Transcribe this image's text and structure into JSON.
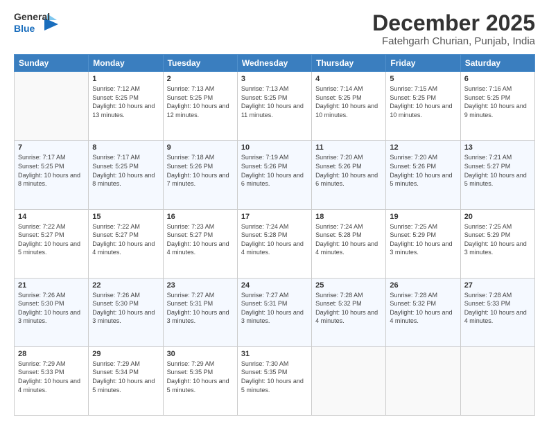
{
  "header": {
    "logo_general": "General",
    "logo_blue": "Blue",
    "month_title": "December 2025",
    "location": "Fatehgarh Churian, Punjab, India"
  },
  "weekdays": [
    "Sunday",
    "Monday",
    "Tuesday",
    "Wednesday",
    "Thursday",
    "Friday",
    "Saturday"
  ],
  "weeks": [
    [
      null,
      {
        "day": 1,
        "sunrise": "7:12 AM",
        "sunset": "5:25 PM",
        "daylight": "10 hours and 13 minutes."
      },
      {
        "day": 2,
        "sunrise": "7:13 AM",
        "sunset": "5:25 PM",
        "daylight": "10 hours and 12 minutes."
      },
      {
        "day": 3,
        "sunrise": "7:13 AM",
        "sunset": "5:25 PM",
        "daylight": "10 hours and 11 minutes."
      },
      {
        "day": 4,
        "sunrise": "7:14 AM",
        "sunset": "5:25 PM",
        "daylight": "10 hours and 10 minutes."
      },
      {
        "day": 5,
        "sunrise": "7:15 AM",
        "sunset": "5:25 PM",
        "daylight": "10 hours and 10 minutes."
      },
      {
        "day": 6,
        "sunrise": "7:16 AM",
        "sunset": "5:25 PM",
        "daylight": "10 hours and 9 minutes."
      }
    ],
    [
      {
        "day": 7,
        "sunrise": "7:17 AM",
        "sunset": "5:25 PM",
        "daylight": "10 hours and 8 minutes."
      },
      {
        "day": 8,
        "sunrise": "7:17 AM",
        "sunset": "5:25 PM",
        "daylight": "10 hours and 8 minutes."
      },
      {
        "day": 9,
        "sunrise": "7:18 AM",
        "sunset": "5:26 PM",
        "daylight": "10 hours and 7 minutes."
      },
      {
        "day": 10,
        "sunrise": "7:19 AM",
        "sunset": "5:26 PM",
        "daylight": "10 hours and 6 minutes."
      },
      {
        "day": 11,
        "sunrise": "7:20 AM",
        "sunset": "5:26 PM",
        "daylight": "10 hours and 6 minutes."
      },
      {
        "day": 12,
        "sunrise": "7:20 AM",
        "sunset": "5:26 PM",
        "daylight": "10 hours and 5 minutes."
      },
      {
        "day": 13,
        "sunrise": "7:21 AM",
        "sunset": "5:27 PM",
        "daylight": "10 hours and 5 minutes."
      }
    ],
    [
      {
        "day": 14,
        "sunrise": "7:22 AM",
        "sunset": "5:27 PM",
        "daylight": "10 hours and 5 minutes."
      },
      {
        "day": 15,
        "sunrise": "7:22 AM",
        "sunset": "5:27 PM",
        "daylight": "10 hours and 4 minutes."
      },
      {
        "day": 16,
        "sunrise": "7:23 AM",
        "sunset": "5:27 PM",
        "daylight": "10 hours and 4 minutes."
      },
      {
        "day": 17,
        "sunrise": "7:24 AM",
        "sunset": "5:28 PM",
        "daylight": "10 hours and 4 minutes."
      },
      {
        "day": 18,
        "sunrise": "7:24 AM",
        "sunset": "5:28 PM",
        "daylight": "10 hours and 4 minutes."
      },
      {
        "day": 19,
        "sunrise": "7:25 AM",
        "sunset": "5:29 PM",
        "daylight": "10 hours and 3 minutes."
      },
      {
        "day": 20,
        "sunrise": "7:25 AM",
        "sunset": "5:29 PM",
        "daylight": "10 hours and 3 minutes."
      }
    ],
    [
      {
        "day": 21,
        "sunrise": "7:26 AM",
        "sunset": "5:30 PM",
        "daylight": "10 hours and 3 minutes."
      },
      {
        "day": 22,
        "sunrise": "7:26 AM",
        "sunset": "5:30 PM",
        "daylight": "10 hours and 3 minutes."
      },
      {
        "day": 23,
        "sunrise": "7:27 AM",
        "sunset": "5:31 PM",
        "daylight": "10 hours and 3 minutes."
      },
      {
        "day": 24,
        "sunrise": "7:27 AM",
        "sunset": "5:31 PM",
        "daylight": "10 hours and 3 minutes."
      },
      {
        "day": 25,
        "sunrise": "7:28 AM",
        "sunset": "5:32 PM",
        "daylight": "10 hours and 4 minutes."
      },
      {
        "day": 26,
        "sunrise": "7:28 AM",
        "sunset": "5:32 PM",
        "daylight": "10 hours and 4 minutes."
      },
      {
        "day": 27,
        "sunrise": "7:28 AM",
        "sunset": "5:33 PM",
        "daylight": "10 hours and 4 minutes."
      }
    ],
    [
      {
        "day": 28,
        "sunrise": "7:29 AM",
        "sunset": "5:33 PM",
        "daylight": "10 hours and 4 minutes."
      },
      {
        "day": 29,
        "sunrise": "7:29 AM",
        "sunset": "5:34 PM",
        "daylight": "10 hours and 5 minutes."
      },
      {
        "day": 30,
        "sunrise": "7:29 AM",
        "sunset": "5:35 PM",
        "daylight": "10 hours and 5 minutes."
      },
      {
        "day": 31,
        "sunrise": "7:30 AM",
        "sunset": "5:35 PM",
        "daylight": "10 hours and 5 minutes."
      },
      null,
      null,
      null
    ]
  ],
  "labels": {
    "sunrise": "Sunrise:",
    "sunset": "Sunset:",
    "daylight": "Daylight:"
  }
}
